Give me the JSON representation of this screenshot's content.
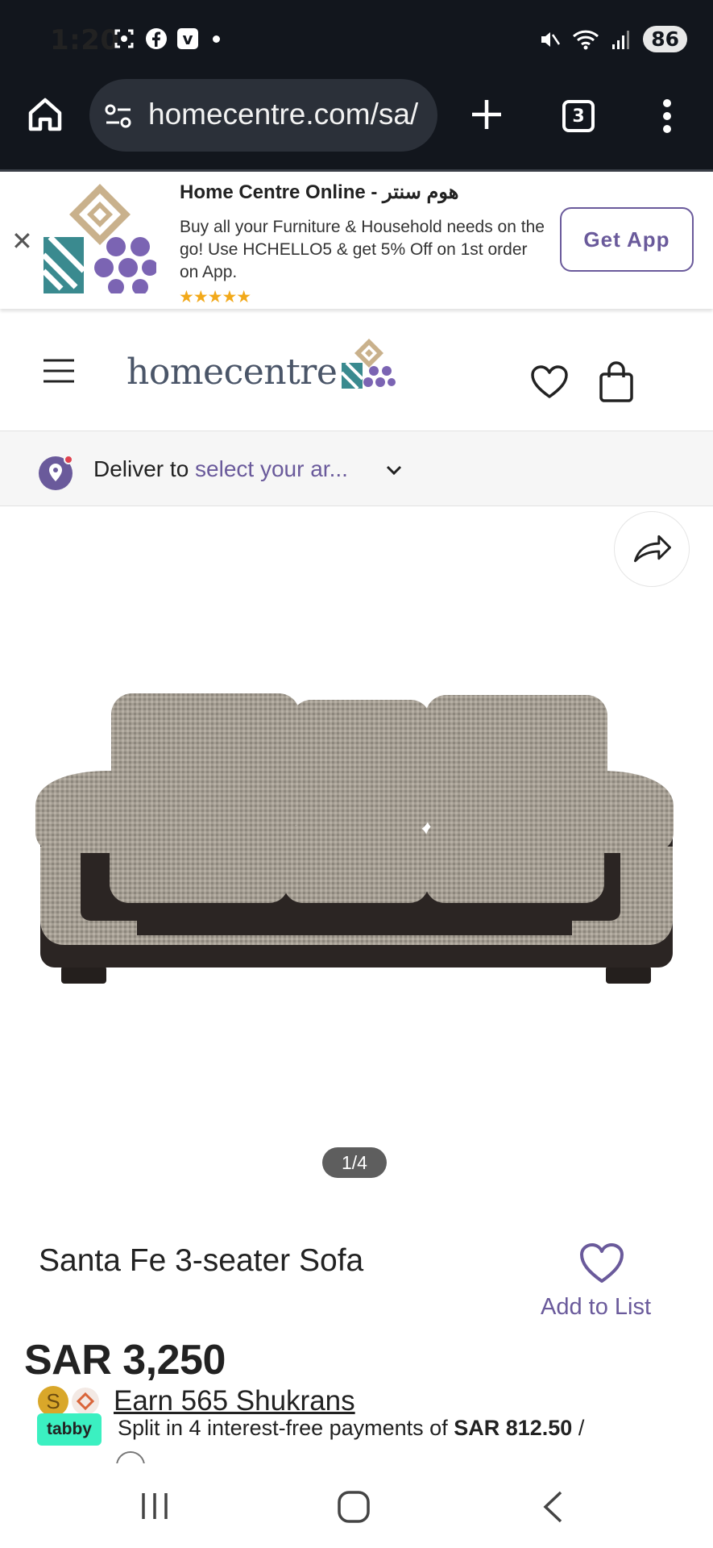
{
  "status_bar": {
    "time": "1:20",
    "left_icons": [
      "screenshot-icon",
      "facebook-icon",
      "vimeo-icon"
    ],
    "battery": "86",
    "right_icons": [
      "mute-icon",
      "wifi-icon",
      "signal-icon"
    ]
  },
  "browser": {
    "url": "homecentre.com/sa/",
    "tab_count": "3"
  },
  "app_banner": {
    "title": "Home Centre Online - هوم سنتر",
    "description": "Buy all your Furniture & Household needs on the go! Use HCHELLO5 & get 5% Off on 1st order on App.",
    "stars": "★★★★★",
    "button_label": "Get App",
    "close_label": "✕"
  },
  "header": {
    "logo_text": "homecentre"
  },
  "deliver": {
    "prefix": "Deliver to",
    "link_text": "select your ar..."
  },
  "gallery": {
    "pager": "1/4"
  },
  "product": {
    "title": "Santa Fe 3-seater Sofa",
    "add_to_list": "Add to List",
    "price": "SAR 3,250",
    "shukran_text": "Earn 565 Shukrans",
    "tabby_badge": "tabby",
    "tabby_text_prefix": "Split in 4 interest-free payments of",
    "tabby_amount": "SAR 812.50",
    "tabby_suffix": "/"
  },
  "colors": {
    "brand_purple": "#6a5a9b",
    "dark_bar": "#12161d",
    "tabby_green": "#3bf0c1"
  }
}
